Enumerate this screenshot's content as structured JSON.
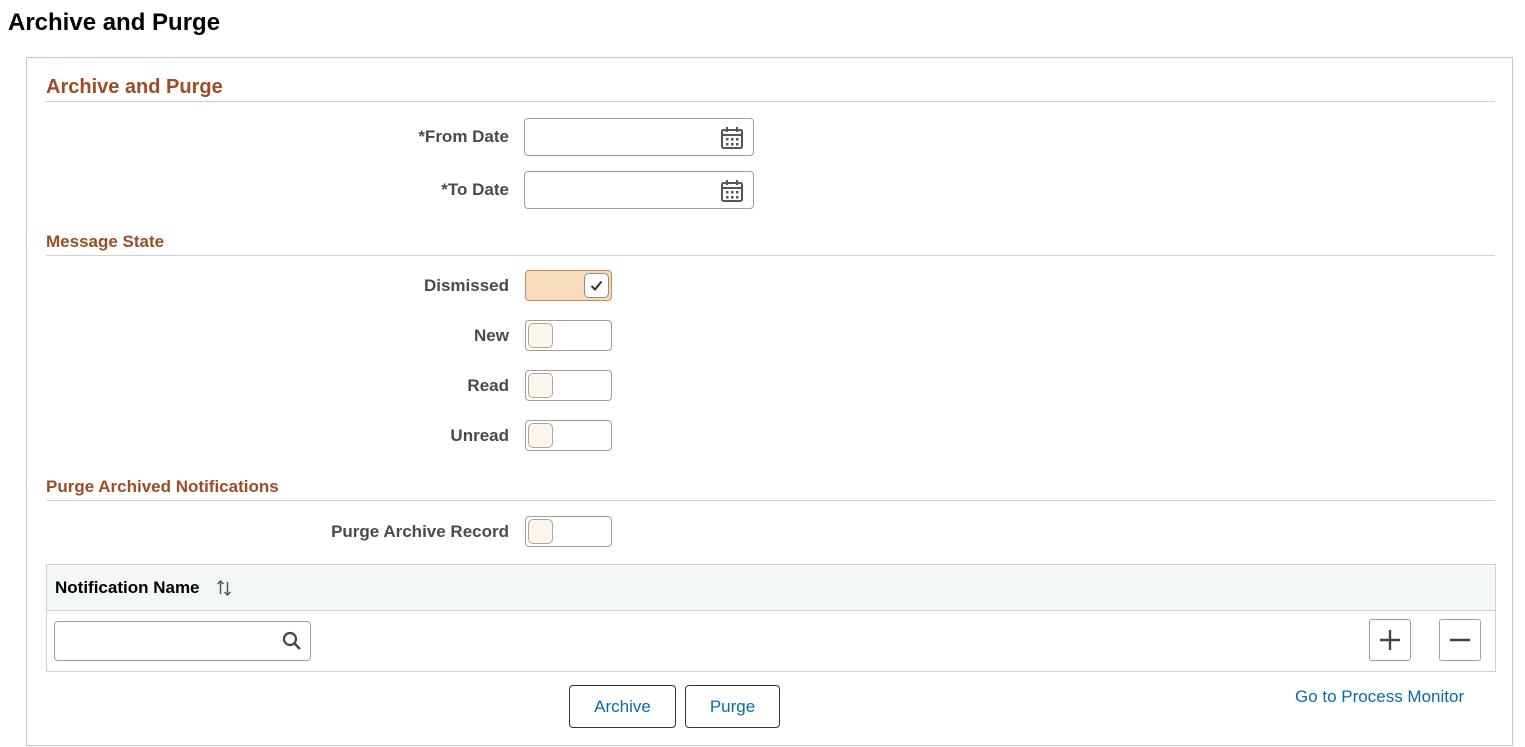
{
  "page": {
    "title": "Archive and Purge"
  },
  "sections": {
    "archive_purge": "Archive and Purge",
    "message_state": "Message State",
    "purge_archived": "Purge Archived Notifications"
  },
  "fields": {
    "from_date": {
      "label": "*From Date",
      "value": ""
    },
    "to_date": {
      "label": "*To Date",
      "value": ""
    },
    "dismissed": {
      "label": "Dismissed",
      "checked": true
    },
    "new": {
      "label": "New",
      "checked": false
    },
    "read": {
      "label": "Read",
      "checked": false
    },
    "unread": {
      "label": "Unread",
      "checked": false
    },
    "purge_archive_record": {
      "label": "Purge Archive Record",
      "checked": false
    }
  },
  "grid": {
    "column": "Notification Name",
    "search_value": ""
  },
  "buttons": {
    "archive": "Archive",
    "purge": "Purge"
  },
  "links": {
    "process_monitor": "Go to Process Monitor"
  },
  "icons": {
    "calendar": "calendar-icon",
    "check": "check-icon",
    "sort": "sort-icon",
    "search": "search-icon",
    "add": "plus-icon",
    "remove": "minus-icon"
  },
  "colors": {
    "section_heading": "#9c4c27",
    "link": "#0a6aa8",
    "toggle_on": "#f6dcbc"
  }
}
